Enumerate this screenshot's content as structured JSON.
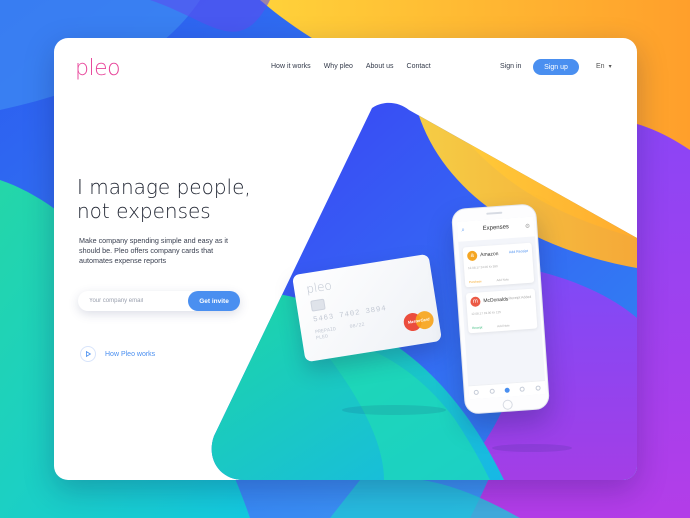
{
  "brand": {
    "logo_text": "pleo",
    "accent": "#4a8ff0",
    "logo_color": "#e8479b"
  },
  "nav": {
    "items": [
      {
        "label": "How it works"
      },
      {
        "label": "Why pleo"
      },
      {
        "label": "About us"
      },
      {
        "label": "Contact"
      }
    ],
    "sign_in": "Sign in",
    "sign_up": "Sign up",
    "language": "En"
  },
  "hero": {
    "title_line1": "I manage people,",
    "title_line2": "not expenses",
    "subtitle": "Make company spending simple and easy as it should be. Pleo offers company cards that automates expense reports",
    "email_placeholder": "Your company email",
    "cta": "Get invite",
    "how_link": "How Pleo works"
  },
  "card": {
    "brand": "pleo",
    "number": "5463 7402 3894",
    "holder_line1": "PREPAID",
    "holder_line2": "PLEO",
    "expiry": "08/22",
    "network": "MasterCard"
  },
  "phone": {
    "title": "Expenses",
    "expenses": [
      {
        "merchant": "Amazon",
        "icon_letter": "a",
        "tag": "Add Receipt",
        "details": "12.08.17    24.00    Kr 390",
        "footer_left": "Purchase",
        "footer_right": "Add Note",
        "icon_color": "#f5a623"
      },
      {
        "merchant": "McDonalds",
        "icon_letter": "m",
        "tag": "Receipt Added",
        "details": "12.08.17    19.00    Kr 125",
        "footer_left": "Receipt",
        "footer_right": "Add Note",
        "icon_color": "#eb5a46"
      }
    ]
  }
}
